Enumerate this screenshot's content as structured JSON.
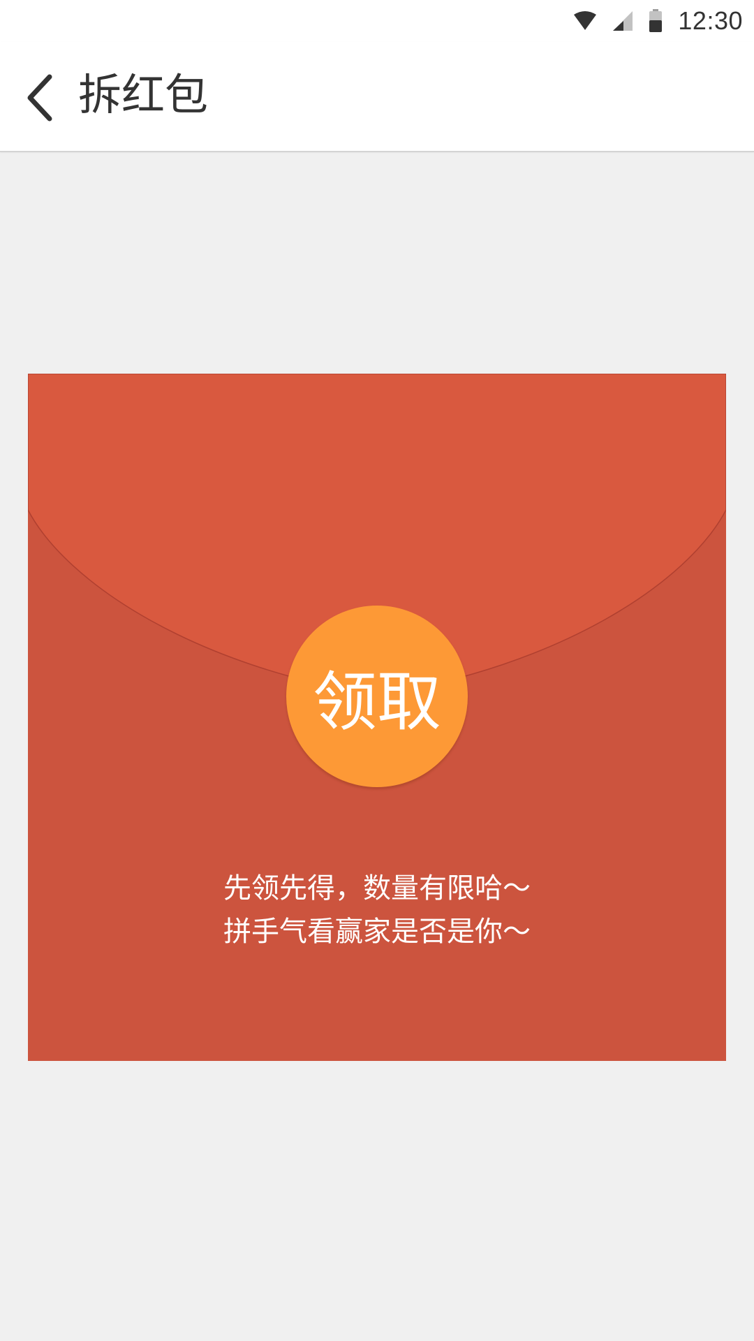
{
  "status_bar": {
    "time": "12:30",
    "icons": [
      "wifi-icon",
      "cell-signal-icon",
      "battery-icon"
    ]
  },
  "app_bar": {
    "back_icon": "chevron-left-icon",
    "title": "拆红包"
  },
  "envelope": {
    "button_label": "领取",
    "tip_line_1": "先领先得，数量有限哈～",
    "tip_line_2": "拼手气看赢家是否是你～",
    "colors": {
      "body": "#cc543e",
      "flap": "#d9593f",
      "button": "#fd9936",
      "page_background": "#f0f0f0"
    }
  }
}
